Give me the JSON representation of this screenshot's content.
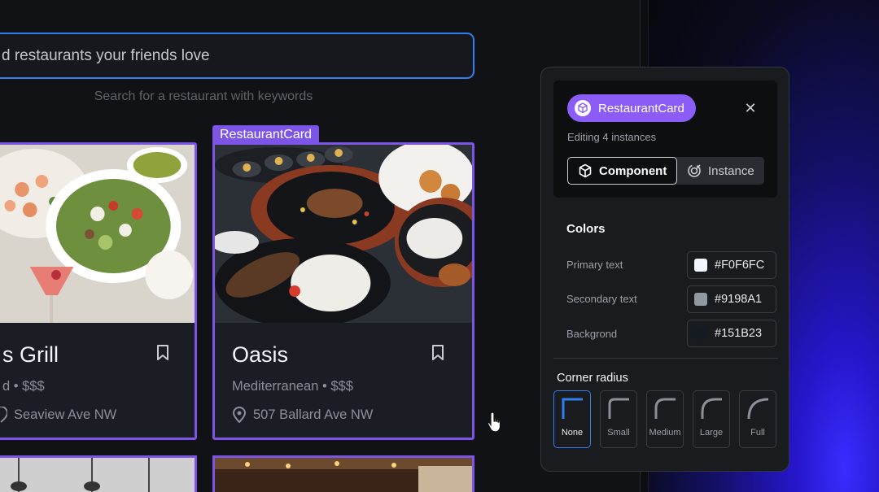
{
  "search": {
    "value": "d restaurants your friends love",
    "hint": "Search for a restaurant with keywords"
  },
  "card_tag": "RestaurantCard",
  "cards": [
    {
      "title": "s Grill",
      "subtitle": "d • $$$",
      "address": "Seaview Ave NW"
    },
    {
      "title": "Oasis",
      "subtitle": "Mediterranean • $$$",
      "address": "507 Ballard Ave NW"
    }
  ],
  "panel": {
    "component_name": "RestaurantCard",
    "editing_text": "Editing 4 instances",
    "close_icon": "close-icon",
    "segments": {
      "component": "Component",
      "instance": "Instance"
    },
    "colors_title": "Colors",
    "colors": [
      {
        "label": "Primary text",
        "value": "#F0F6FC",
        "swatch": "#F0F6FC"
      },
      {
        "label": "Secondary text",
        "value": "#9198A1",
        "swatch": "#9198A1"
      },
      {
        "label": "Backgrond",
        "value": "#151B23",
        "swatch": "#151B23"
      }
    ],
    "radius_title": "Corner radius",
    "radius_options": [
      "None",
      "Small",
      "Medium",
      "Large",
      "Full"
    ],
    "radius_selected": "None"
  },
  "theme": {
    "accent": "#7C55E6",
    "focus": "#2F7FF0",
    "pill": "#8B5CF6"
  }
}
